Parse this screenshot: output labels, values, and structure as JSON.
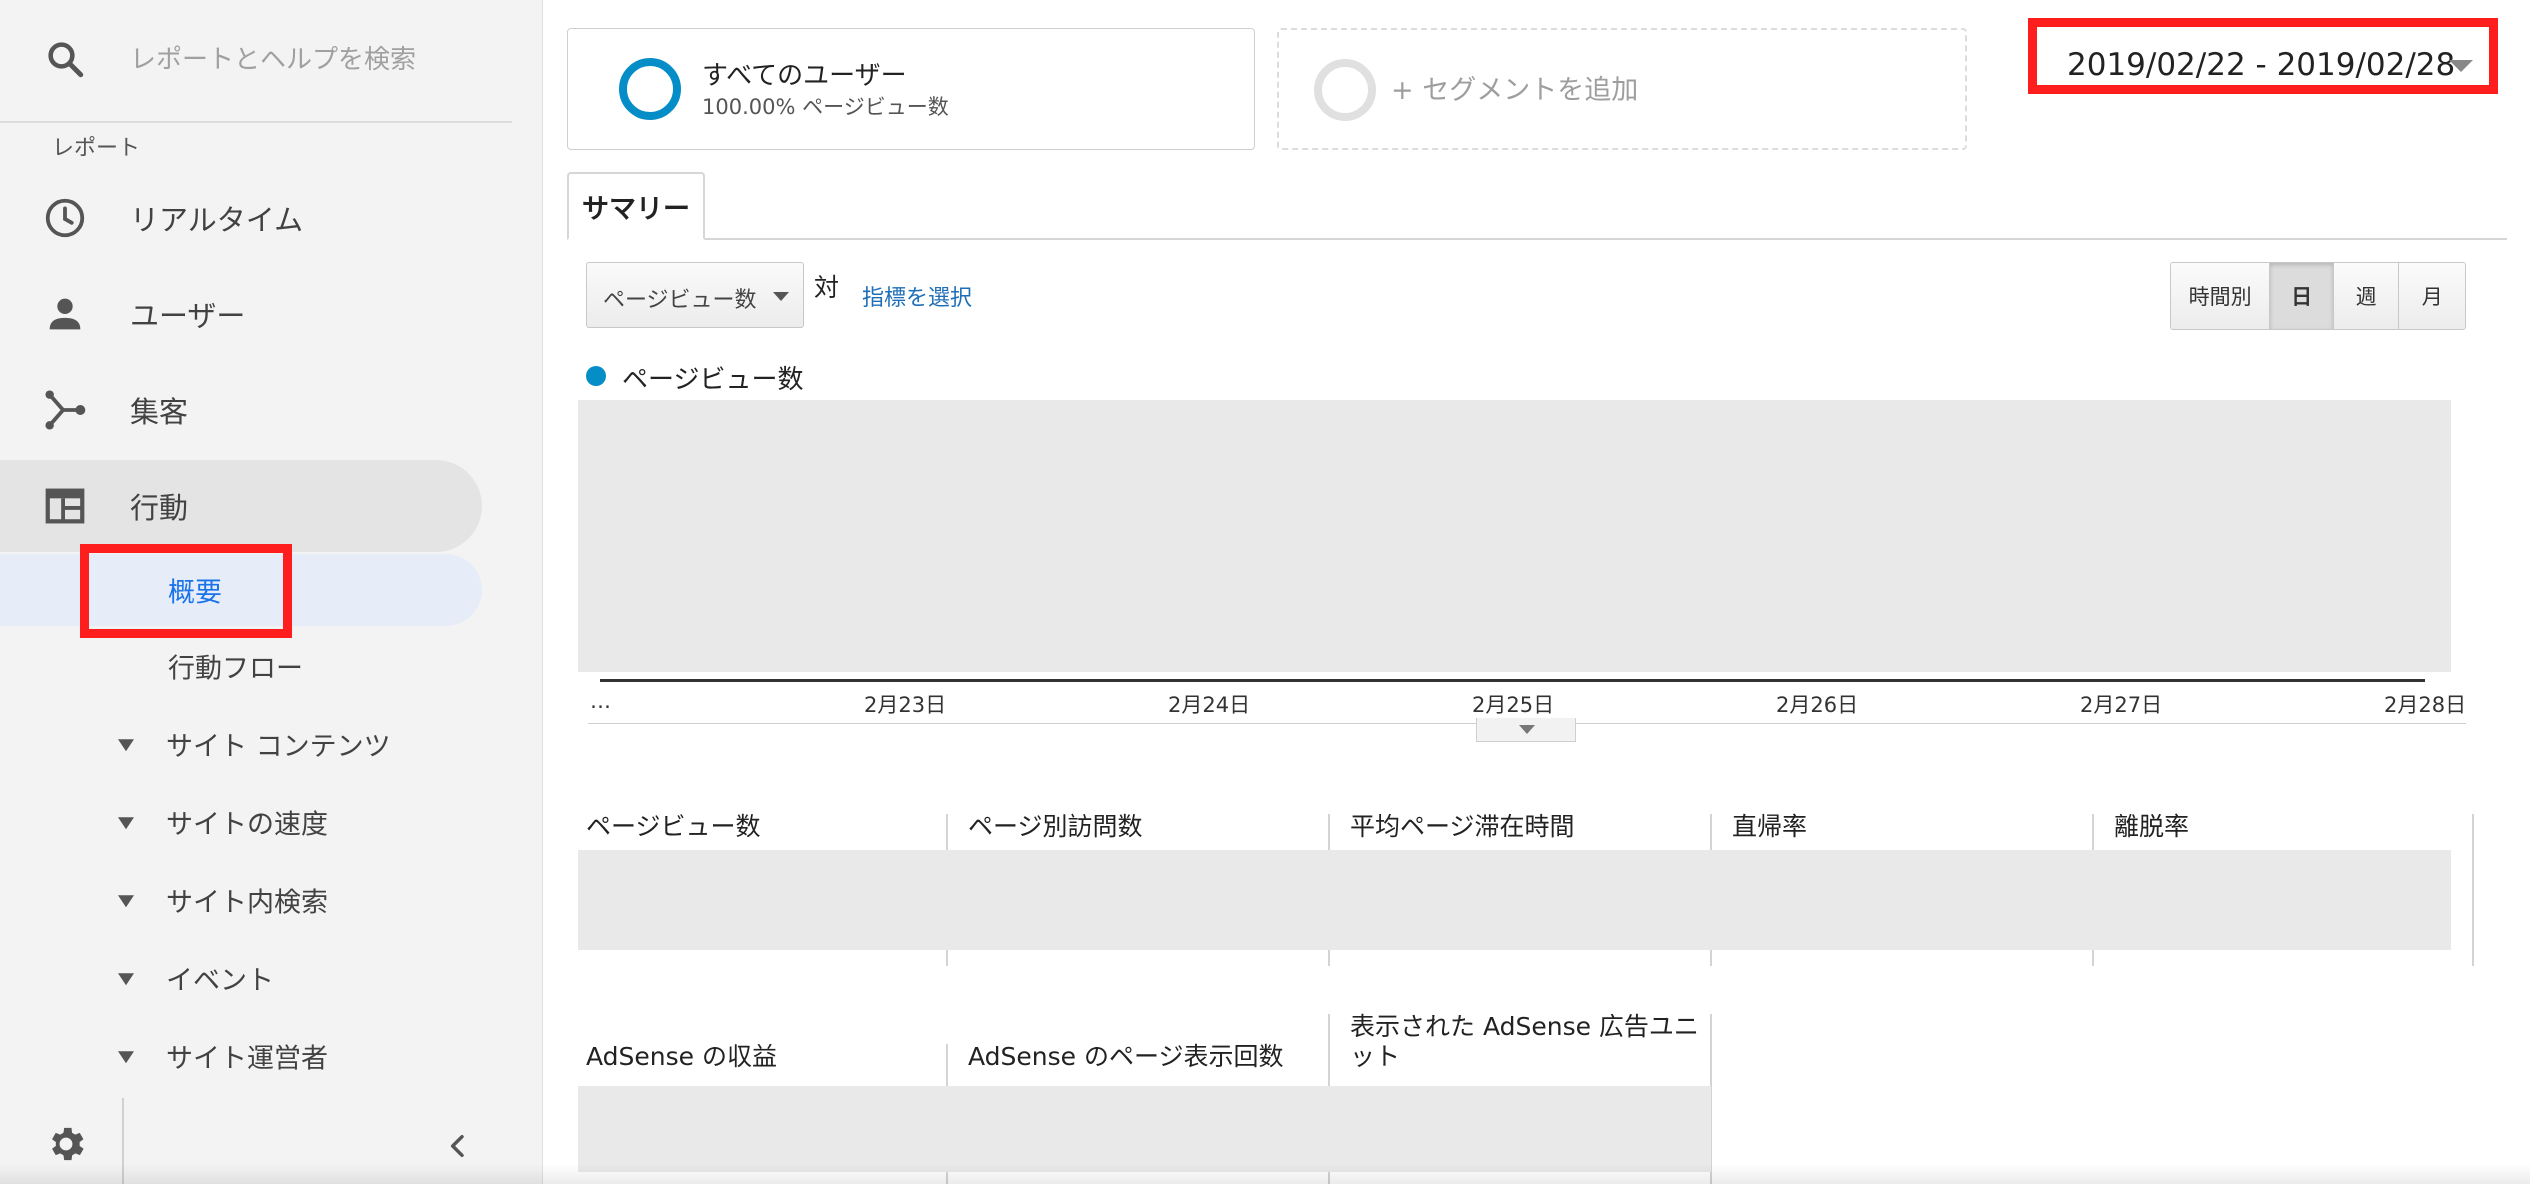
{
  "search": {
    "placeholder": "レポートとヘルプを検索"
  },
  "sidebar": {
    "reports_heading": "レポート",
    "items": [
      {
        "label": "リアルタイム",
        "icon": "clock-icon"
      },
      {
        "label": "ユーザー",
        "icon": "person-icon"
      },
      {
        "label": "集客",
        "icon": "acquisition-icon"
      },
      {
        "label": "行動",
        "icon": "behavior-icon"
      }
    ],
    "sub_items": [
      {
        "label": "概要"
      },
      {
        "label": "行動フロー"
      },
      {
        "label": "サイト コンテンツ"
      },
      {
        "label": "サイトの速度"
      },
      {
        "label": "サイト内検索"
      },
      {
        "label": "イベント"
      },
      {
        "label": "サイト運営者"
      }
    ],
    "settings_icon": "gear-icon",
    "collapse_icon": "chevron-left-icon"
  },
  "segments": {
    "all_users": {
      "title": "すべてのユーザー",
      "subtitle": "100.00% ページビュー数"
    },
    "add_label": "+ セグメントを追加"
  },
  "date_range": {
    "value": "2019/02/22 - 2019/02/28"
  },
  "tabs": {
    "summary": "サマリー"
  },
  "metric_controls": {
    "selected_metric": "ページビュー数",
    "versus": "対",
    "choose_metric": "指標を選択"
  },
  "granularity": {
    "options": [
      "時間別",
      "日",
      "週",
      "月"
    ],
    "active": "日"
  },
  "chart_data": {
    "type": "line",
    "series": [
      {
        "name": "ページビュー数",
        "values": []
      }
    ],
    "categories": [
      "…",
      "2月23日",
      "2月24日",
      "2月25日",
      "2月26日",
      "2月27日",
      "2月28日"
    ],
    "colors": {
      "series": "#058dc7"
    }
  },
  "stats": {
    "row1": [
      "ページビュー数",
      "ページ別訪問数",
      "平均ページ滞在時間",
      "直帰率",
      "離脱率"
    ],
    "row2": [
      "AdSense の収益",
      "AdSense のページ表示回数",
      "表示された AdSense 広告ユニット"
    ]
  },
  "colors": {
    "highlight": "#ff1e1e",
    "accent": "#1a73e8",
    "link": "#1f6fb8"
  }
}
